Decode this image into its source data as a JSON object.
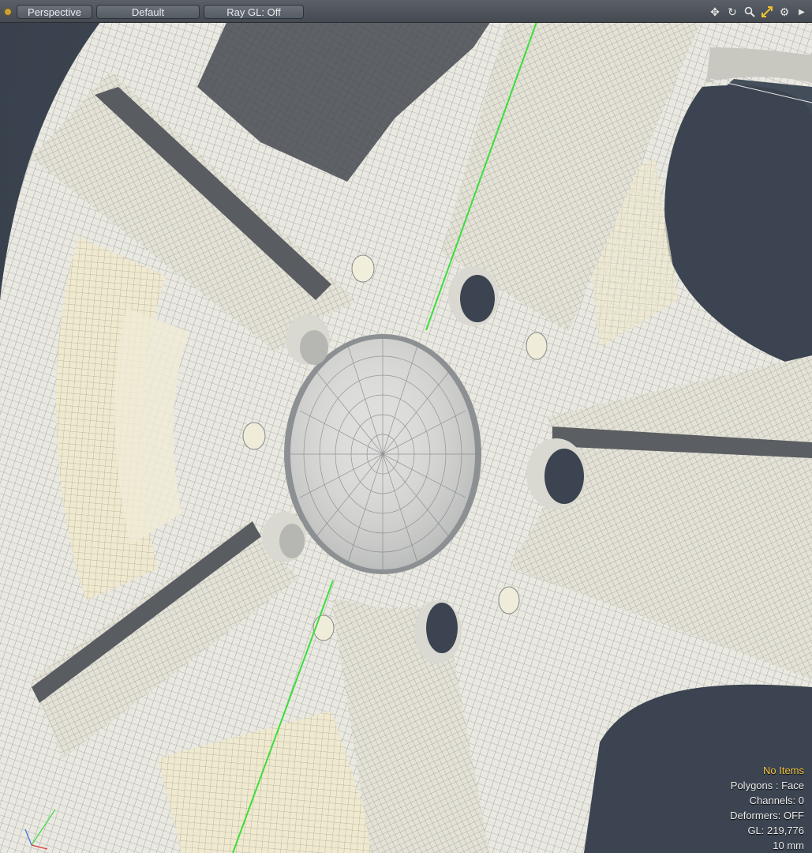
{
  "toolbar": {
    "view_mode": "Perspective",
    "shading": "Default",
    "ray_gl": "Ray GL: Off",
    "icons": [
      "move-view-icon",
      "rotate-view-icon",
      "zoom-view-icon",
      "fit-view-icon",
      "settings-icon",
      "expand-icon"
    ]
  },
  "info": {
    "selection": "No Items",
    "polygons": "Polygons : Face",
    "channels": "Channels: 0",
    "deformers": "Deformers: OFF",
    "gl": "GL: 219,776",
    "scale": "10 mm"
  },
  "colors": {
    "accent": "#f5c542",
    "mesh": "#e7e6df",
    "background": "#3b4450",
    "guide_line": "#3ddc3d"
  }
}
